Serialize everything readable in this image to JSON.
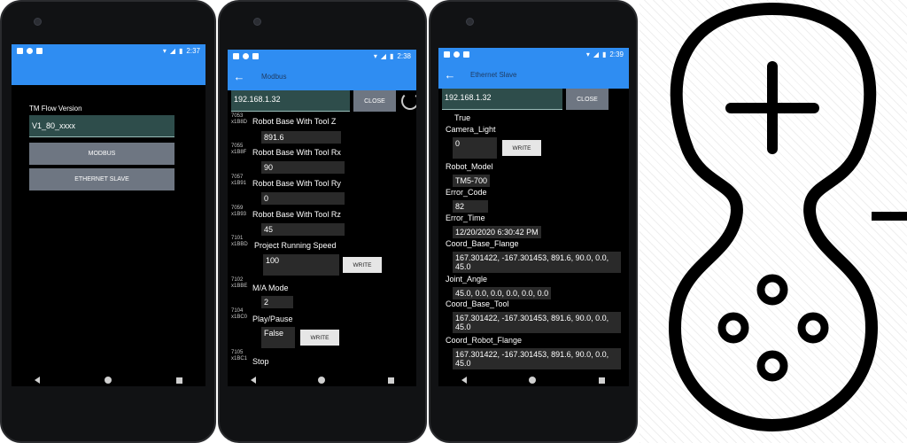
{
  "phone1": {
    "status_time": "2:37",
    "tm_flow_label": "TM Flow Version",
    "tm_flow_value": "V1_80_xxxx",
    "modbus_button": "MODBUS",
    "ethernet_button": "ETHERNET SLAVE"
  },
  "phone2": {
    "status_time": "2:38",
    "title": "Modbus",
    "ip": "192.168.1.32",
    "close_button": "CLOSE",
    "write_label": "WRITE",
    "items": [
      {
        "addr": "7053",
        "hex": "x1B8D",
        "label": "Robot Base With Tool Z",
        "value": "891.6"
      },
      {
        "addr": "7055",
        "hex": "x1B8F",
        "label": "Robot Base With Tool Rx",
        "value": "90"
      },
      {
        "addr": "7057",
        "hex": "x1B91",
        "label": "Robot Base With Tool Ry",
        "value": "0"
      },
      {
        "addr": "7059",
        "hex": "x1B93",
        "label": "Robot Base With Tool Rz",
        "value": "45"
      },
      {
        "addr": "7101",
        "hex": "x1BBD",
        "label": "Project Running Speed",
        "value": "100"
      },
      {
        "addr": "7102",
        "hex": "x1BBE",
        "label": "M/A Mode",
        "value": "2"
      },
      {
        "addr": "7104",
        "hex": "x1BC0",
        "label": "Play/Pause",
        "value": "False"
      },
      {
        "addr": "7105",
        "hex": "x1BC1",
        "label": "Stop",
        "value": ""
      }
    ]
  },
  "phone3": {
    "status_time": "2:39",
    "title": "Ethernet Slave",
    "ip": "192.168.1.32",
    "close_button": "CLOSE",
    "write_label": "WRITE",
    "top_value": "True",
    "camera_light_label": "Camera_Light",
    "camera_light_value": "0",
    "robot_model_label": "Robot_Model",
    "robot_model_value": "TM5-700",
    "error_code_label": "Error_Code",
    "error_code_value": "82",
    "error_time_label": "Error_Time",
    "error_time_value": "12/20/2020 6:30:42 PM",
    "coord_base_flange_label": "Coord_Base_Flange",
    "coord_base_flange_line1": "167.301422,  -167.301453,  891.6,  90.0,  0.0,",
    "coord_base_flange_line2": "45.0",
    "joint_angle_label": "Joint_Angle",
    "joint_angle_value": "45.0,  0.0,  0.0,  0.0,  0.0,  0.0",
    "coord_base_tool_label": "Coord_Base_Tool",
    "coord_base_tool_line1": "167.301422,  -167.301453,  891.6,  90.0,  0.0,",
    "coord_base_tool_line2": "45.0",
    "coord_robot_flange_label": "Coord_Robot_Flange",
    "coord_robot_flange_line1": "167.301422,  -167.301453,  891.6,  90.0,  0.0,",
    "coord_robot_flange_line2": "45.0"
  },
  "colors": {
    "accent": "#2f8df2",
    "input_bg": "#2e4d4b",
    "button_gray": "#6e7682"
  },
  "icons": [
    "back-arrow-icon",
    "wifi-icon",
    "signal-icon",
    "battery-icon",
    "gamepad-icon"
  ]
}
